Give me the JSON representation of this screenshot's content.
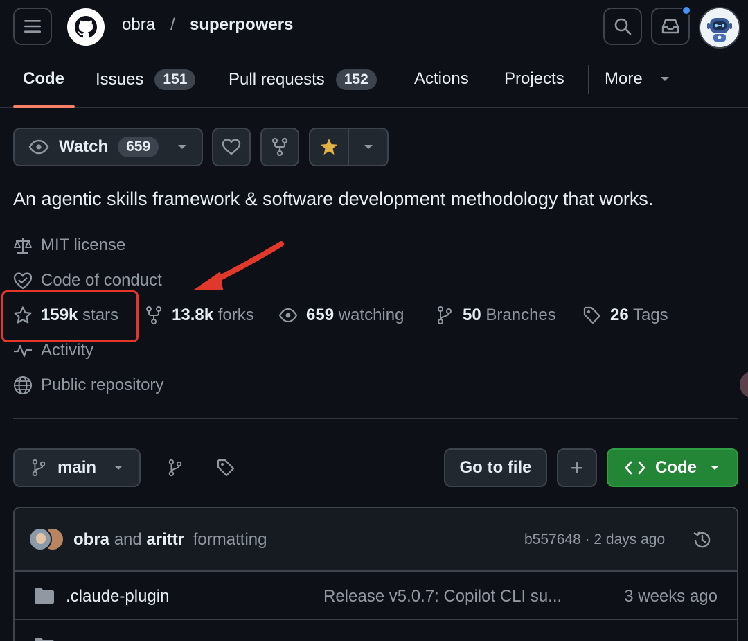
{
  "header": {
    "owner": "obra",
    "separator": "/",
    "repo": "superpowers"
  },
  "tabs": [
    {
      "label": "Code"
    },
    {
      "label": "Issues",
      "count": "151"
    },
    {
      "label": "Pull requests",
      "count": "152"
    },
    {
      "label": "Actions"
    },
    {
      "label": "Projects"
    },
    {
      "label": "More"
    }
  ],
  "actions": {
    "watch_label": "Watch",
    "watch_count": "659"
  },
  "description": "An agentic skills framework & software development methodology that works.",
  "meta": {
    "license": "MIT license",
    "conduct": "Code of conduct",
    "stars_count": "159k",
    "stars_label": "stars",
    "forks_count": "13.8k",
    "forks_label": "forks",
    "watching_count": "659",
    "watching_label": "watching",
    "branches_count": "50",
    "branches_label": "Branches",
    "tags_count": "26",
    "tags_label": "Tags",
    "activity": "Activity",
    "visibility": "Public repository"
  },
  "branch_bar": {
    "branch": "main",
    "go_to_file": "Go to file",
    "add": "+",
    "code": "Code"
  },
  "commit": {
    "author1": "obra",
    "conjunction": "and",
    "author2": "arittr",
    "message": "formatting",
    "hash_time": "b557648 · 2 days ago"
  },
  "files": [
    {
      "name": ".claude-plugin",
      "message": "Release v5.0.7: Copilot CLI su...",
      "date": "3 weeks ago"
    }
  ],
  "colors": {
    "background": "#0d1117",
    "accent_tab": "#f78166",
    "code_button": "#238636",
    "star": "#e3b341",
    "annotation": "#e0392b"
  },
  "annotation": {
    "highlight": "stars",
    "arrow_points_to": "stars"
  }
}
